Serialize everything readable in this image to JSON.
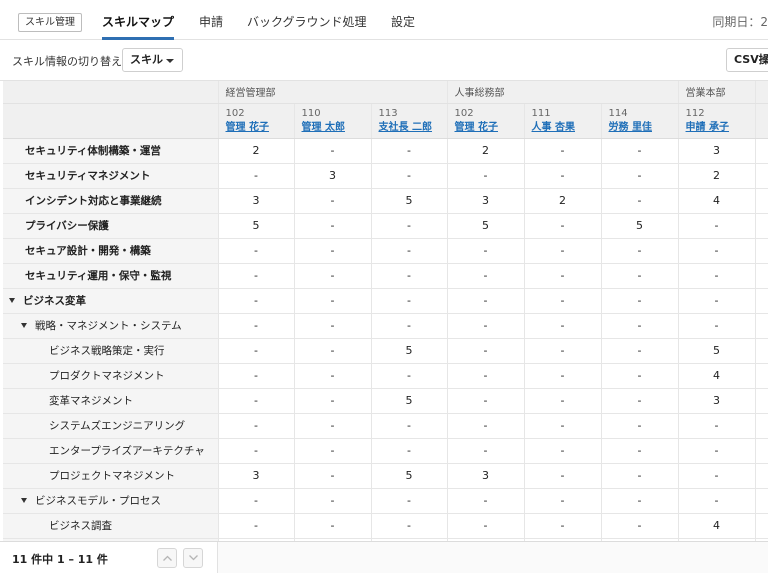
{
  "nav": {
    "app_badge": "スキル管理",
    "tabs": [
      {
        "label": "スキルマップ",
        "active": true
      },
      {
        "label": "申請",
        "active": false
      },
      {
        "label": "バックグラウンド処理",
        "active": false
      },
      {
        "label": "設定",
        "active": false
      }
    ],
    "sync_label": "同期日：2"
  },
  "toolbar": {
    "switch_label": "スキル情報の切り替え",
    "select_value": "スキル",
    "csv_label": "CSV操作"
  },
  "colors": {
    "accent": "#2f6fb2",
    "link": "#1f6fb8"
  },
  "departments": [
    {
      "name": "経営管理部",
      "span": 3
    },
    {
      "name": "人事総務部",
      "span": 3
    },
    {
      "name": "営業本部",
      "span": 1
    }
  ],
  "members": [
    {
      "id": "102",
      "name": "管理 花子"
    },
    {
      "id": "110",
      "name": "管理 太郎"
    },
    {
      "id": "113",
      "name": "支社長 二郎"
    },
    {
      "id": "102",
      "name": "管理 花子"
    },
    {
      "id": "111",
      "name": "人事 杏果"
    },
    {
      "id": "114",
      "name": "労務 里佳"
    },
    {
      "id": "112",
      "name": "申請 承子"
    }
  ],
  "rows": [
    {
      "label": "セキュリティ体制構築・運営",
      "level": "l0",
      "values": [
        "2",
        "-",
        "-",
        "2",
        "-",
        "-",
        "3"
      ]
    },
    {
      "label": "セキュリティマネジメント",
      "level": "l0",
      "values": [
        "-",
        "3",
        "-",
        "-",
        "-",
        "-",
        "2"
      ]
    },
    {
      "label": "インシデント対応と事業継続",
      "level": "l0",
      "values": [
        "3",
        "-",
        "5",
        "3",
        "2",
        "-",
        "4"
      ]
    },
    {
      "label": "プライバシー保護",
      "level": "l0",
      "values": [
        "5",
        "-",
        "-",
        "5",
        "-",
        "5",
        "-"
      ]
    },
    {
      "label": "セキュア設計・開発・構築",
      "level": "l0",
      "values": [
        "-",
        "-",
        "-",
        "-",
        "-",
        "-",
        "-"
      ]
    },
    {
      "label": "セキュリティ運用・保守・監視",
      "level": "l0",
      "values": [
        "-",
        "-",
        "-",
        "-",
        "-",
        "-",
        "-"
      ]
    },
    {
      "label": "ビジネス変革",
      "level": "g0",
      "values": [
        "-",
        "-",
        "-",
        "-",
        "-",
        "-",
        "-"
      ]
    },
    {
      "label": "戦略・マネジメント・システム",
      "level": "g1",
      "values": [
        "-",
        "-",
        "-",
        "-",
        "-",
        "-",
        "-"
      ]
    },
    {
      "label": "ビジネス戦略策定・実行",
      "level": "l2",
      "values": [
        "-",
        "-",
        "5",
        "-",
        "-",
        "-",
        "5"
      ]
    },
    {
      "label": "プロダクトマネジメント",
      "level": "l2",
      "values": [
        "-",
        "-",
        "-",
        "-",
        "-",
        "-",
        "4"
      ]
    },
    {
      "label": "変革マネジメント",
      "level": "l2",
      "values": [
        "-",
        "-",
        "5",
        "-",
        "-",
        "-",
        "3"
      ]
    },
    {
      "label": "システムズエンジニアリング",
      "level": "l2",
      "values": [
        "-",
        "-",
        "-",
        "-",
        "-",
        "-",
        "-"
      ]
    },
    {
      "label": "エンタープライズアーキテクチャ",
      "level": "l2",
      "values": [
        "-",
        "-",
        "-",
        "-",
        "-",
        "-",
        "-"
      ]
    },
    {
      "label": "プロジェクトマネジメント",
      "level": "l2",
      "values": [
        "3",
        "-",
        "5",
        "3",
        "-",
        "-",
        "-"
      ]
    },
    {
      "label": "ビジネスモデル・プロセス",
      "level": "g1",
      "values": [
        "-",
        "-",
        "-",
        "-",
        "-",
        "-",
        "-"
      ]
    },
    {
      "label": "ビジネス調査",
      "level": "l2",
      "values": [
        "-",
        "-",
        "-",
        "-",
        "-",
        "-",
        "4"
      ]
    },
    {
      "label": "",
      "level": "l2",
      "values": [
        "-",
        "-",
        "-",
        "-",
        "-",
        "-",
        "-"
      ]
    }
  ],
  "footer": {
    "count_text": "11 件中  1 – 11 件"
  }
}
